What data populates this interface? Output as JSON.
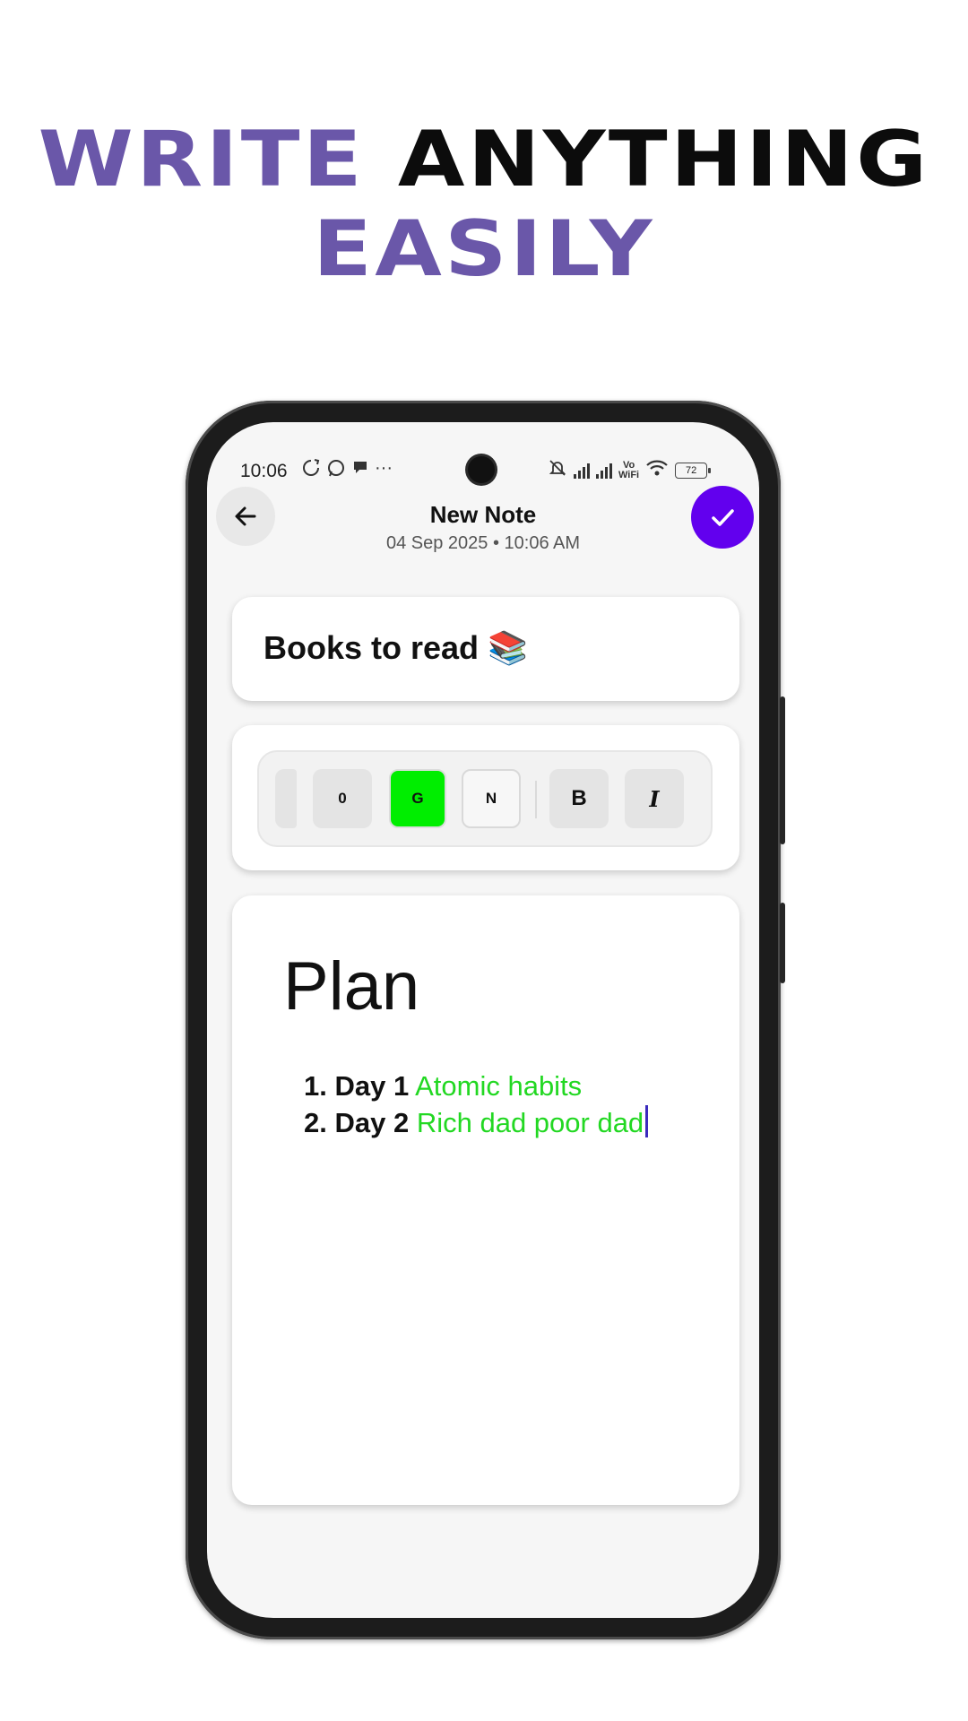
{
  "headline": {
    "word1": "WRITE",
    "word2": "ANYTHING",
    "word3": "EASILY"
  },
  "status_bar": {
    "time": "10:06",
    "more": "···",
    "vowifi_line1": "Vo",
    "vowifi_line2": "WiFi",
    "battery": "72"
  },
  "header": {
    "title": "New Note",
    "subtitle": "04 Sep 2025 • 10:06 AM"
  },
  "note": {
    "title": "Books to read 📚"
  },
  "toolbar": {
    "buttons": [
      "0",
      "G",
      "N",
      "B",
      "I"
    ],
    "active_color": "#00ee00"
  },
  "editor": {
    "heading": "Plan",
    "items": [
      {
        "label": "1. Day 1",
        "value": "Atomic habits"
      },
      {
        "label": "2. Day 2",
        "value": "Rich dad poor dad"
      }
    ],
    "highlight_color": "#22d822"
  },
  "colors": {
    "accent": "#6200ee",
    "headline_purple": "#6a57a9"
  }
}
